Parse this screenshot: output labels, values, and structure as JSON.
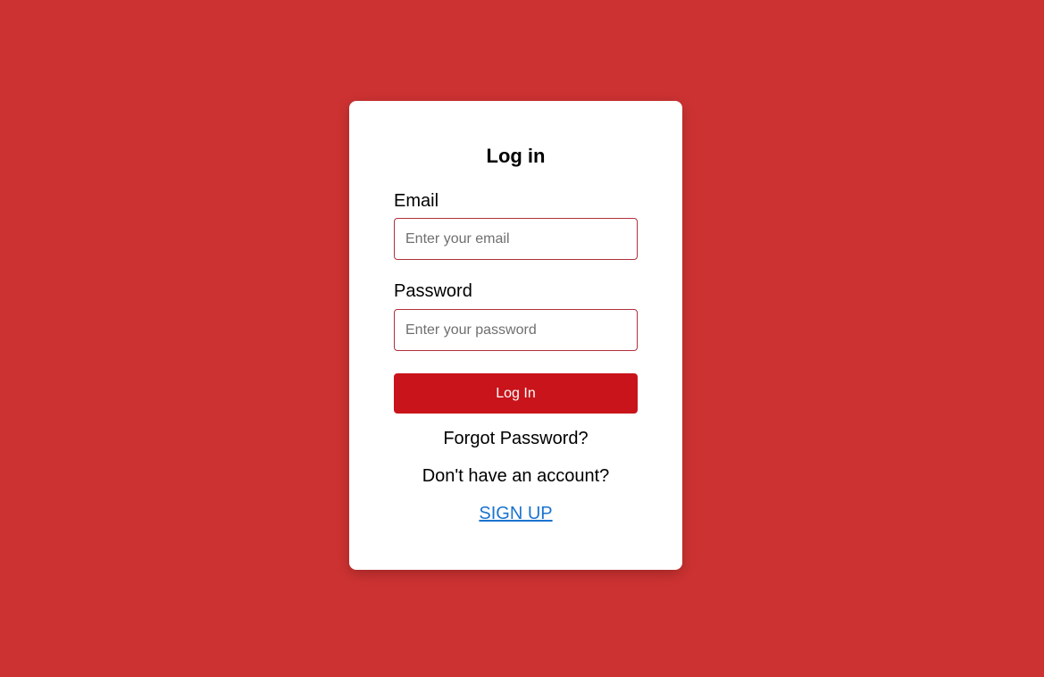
{
  "login_form": {
    "title": "Log in",
    "email_label": "Email",
    "email_placeholder": "Enter your email",
    "email_value": "",
    "password_label": "Password",
    "password_placeholder": "Enter your password",
    "password_value": "",
    "submit_label": "Log In",
    "forgot_password_label": "Forgot Password?",
    "no_account_text": "Don't have an account?",
    "signup_label": "SIGN UP"
  },
  "colors": {
    "background": "#cd3232",
    "card": "#ffffff",
    "button": "#c8141a",
    "input_border": "#b0303c",
    "link": "#1a73d0"
  }
}
